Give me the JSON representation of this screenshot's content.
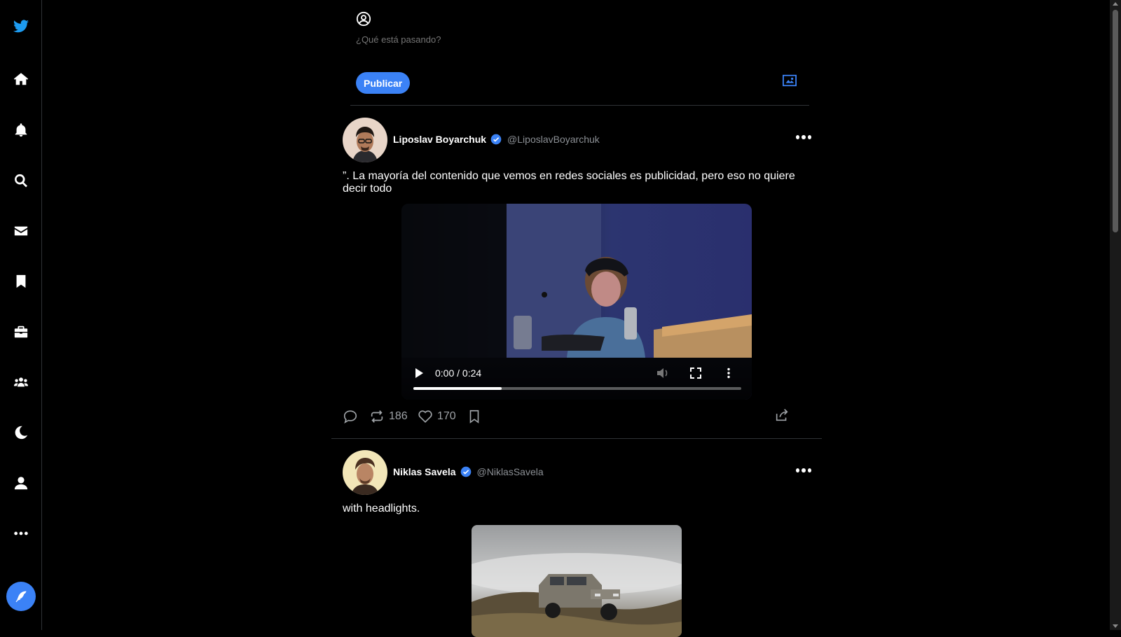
{
  "nav": {
    "items": [
      {
        "name": "twitter-logo-icon"
      },
      {
        "name": "home-icon"
      },
      {
        "name": "notifications-bell-icon"
      },
      {
        "name": "search-icon"
      },
      {
        "name": "messages-envelope-icon"
      },
      {
        "name": "bookmarks-icon"
      },
      {
        "name": "briefcase-icon"
      },
      {
        "name": "communities-icon"
      },
      {
        "name": "dark-mode-moon-icon"
      },
      {
        "name": "profile-user-icon"
      },
      {
        "name": "more-options-icon"
      }
    ],
    "compose_icon": "feather-quill-icon"
  },
  "composer": {
    "placeholder": "¿Qué está pasando?",
    "publish_label": "Publicar",
    "media_icon": "image-icon"
  },
  "colors": {
    "accent": "#3b82f6",
    "background": "#000000",
    "muted_text": "#8b8f94"
  },
  "tweets": [
    {
      "name": "Liposlav Boyarchuk",
      "handle": "@LiposlavBoyarchuk",
      "verified": true,
      "text": "”. La mayoría del contenido que vemos en redes sociales es publicidad, pero eso no quiere decir todo",
      "media": {
        "type": "video",
        "time": "0:00 / 0:24",
        "progress": 0.27
      },
      "stats": {
        "retweets": "186",
        "likes": "170"
      }
    },
    {
      "name": "Niklas Savela",
      "handle": "@NiklasSavela",
      "verified": true,
      "text": "with headlights.",
      "media": {
        "type": "image"
      }
    }
  ]
}
